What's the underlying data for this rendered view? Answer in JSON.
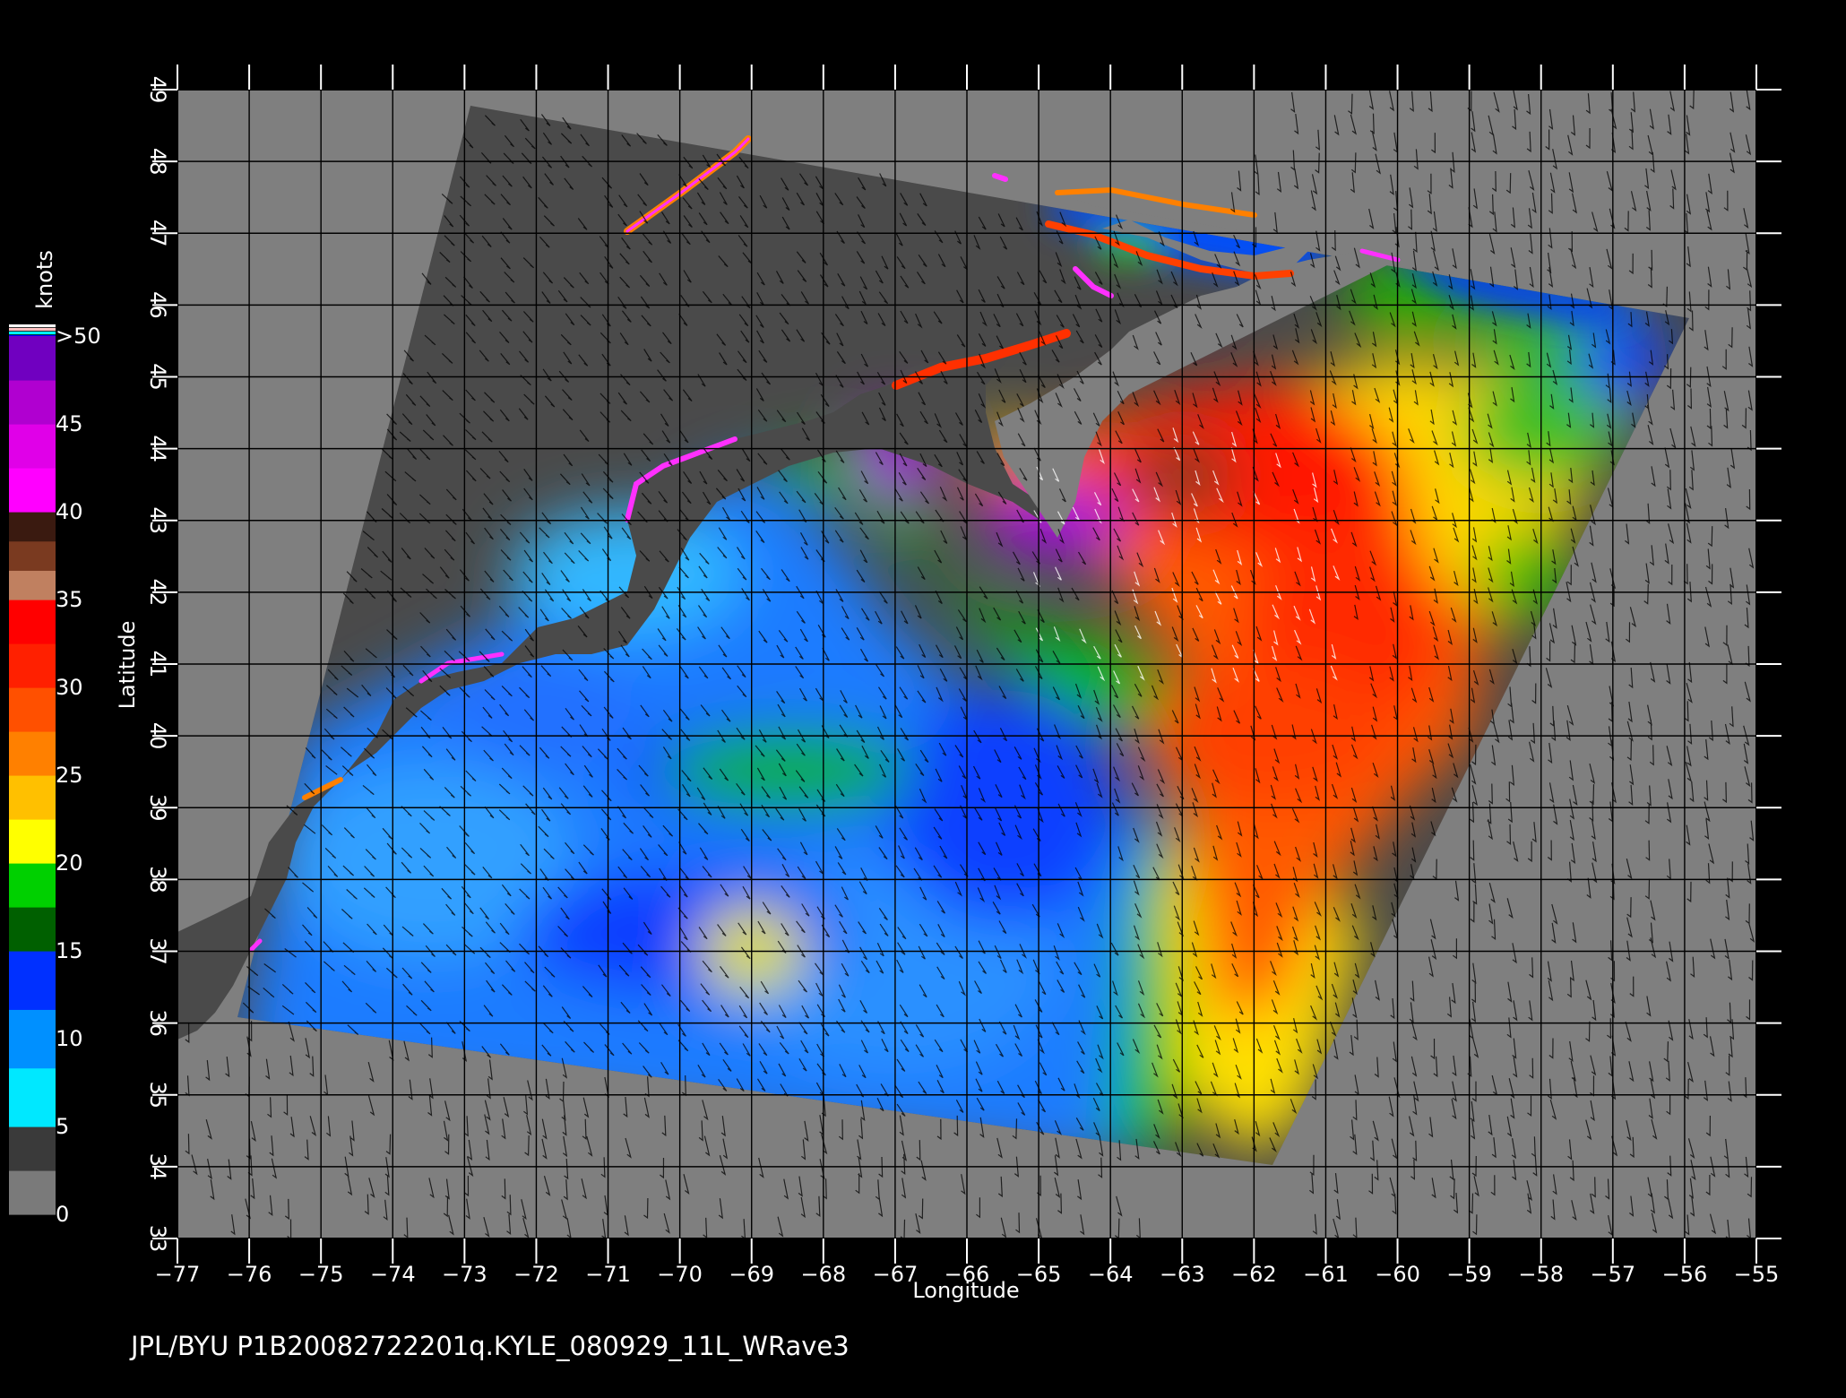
{
  "map": {
    "x_axis": {
      "label": "Longitude",
      "min": -77,
      "max": -55,
      "ticks": [
        "-77",
        "-76",
        "-75",
        "-74",
        "-73",
        "-72",
        "-71",
        "-70",
        "-69",
        "-68",
        "-67",
        "-66",
        "-65",
        "-64",
        "-63",
        "-62",
        "-61",
        "-60",
        "-59",
        "-58",
        "-57",
        "-56",
        "-55"
      ]
    },
    "y_axis": {
      "label": "Latitude",
      "min": 33,
      "max": 49,
      "ticks": [
        "33",
        "34",
        "35",
        "36",
        "37",
        "38",
        "39",
        "40",
        "41",
        "42",
        "43",
        "44",
        "45",
        "46",
        "47",
        "48",
        "49"
      ]
    },
    "grid": true
  },
  "colorbar": {
    "unit": "knots",
    "labels": [
      ">50",
      "45",
      "40",
      "35",
      "30",
      "25",
      "20",
      "15",
      "10",
      "5",
      "0"
    ],
    "bands": [
      {
        "from": 0,
        "to": 5,
        "colors": [
          "#7a7a7a",
          "#3a3a3a"
        ]
      },
      {
        "from": 5,
        "to": 15,
        "colors": [
          "#00e8ff",
          "#0090ff",
          "#0030ff"
        ]
      },
      {
        "from": 15,
        "to": 20,
        "colors": [
          "#006000",
          "#00d000"
        ]
      },
      {
        "from": 20,
        "to": 30,
        "colors": [
          "#ffff00",
          "#ffc000",
          "#ff8000",
          "#ff5000"
        ]
      },
      {
        "from": 30,
        "to": 35,
        "colors": [
          "#ff2000",
          "#ff0000"
        ]
      },
      {
        "from": 35,
        "to": 40,
        "colors": [
          "#c08060",
          "#7a3a20",
          "#3a1a10"
        ]
      },
      {
        "from": 40,
        "to": 45,
        "colors": [
          "#ff00ff",
          "#e000e8"
        ]
      },
      {
        "from": 45,
        "to": 50,
        "colors": [
          "#b000d0",
          "#7000c0"
        ]
      }
    ],
    "top_stripes": [
      "#ffffff",
      "#ffc0c0",
      "#00ffff",
      "#0000ff"
    ]
  },
  "footer_text": "JPL/BYU  P1B20082722201q.KYLE_080929_11L_WRave3",
  "colors": {
    "background": "#000000",
    "land": "#7f7f7f",
    "no_data": "#4a4a4a",
    "grid": "#000000"
  }
}
